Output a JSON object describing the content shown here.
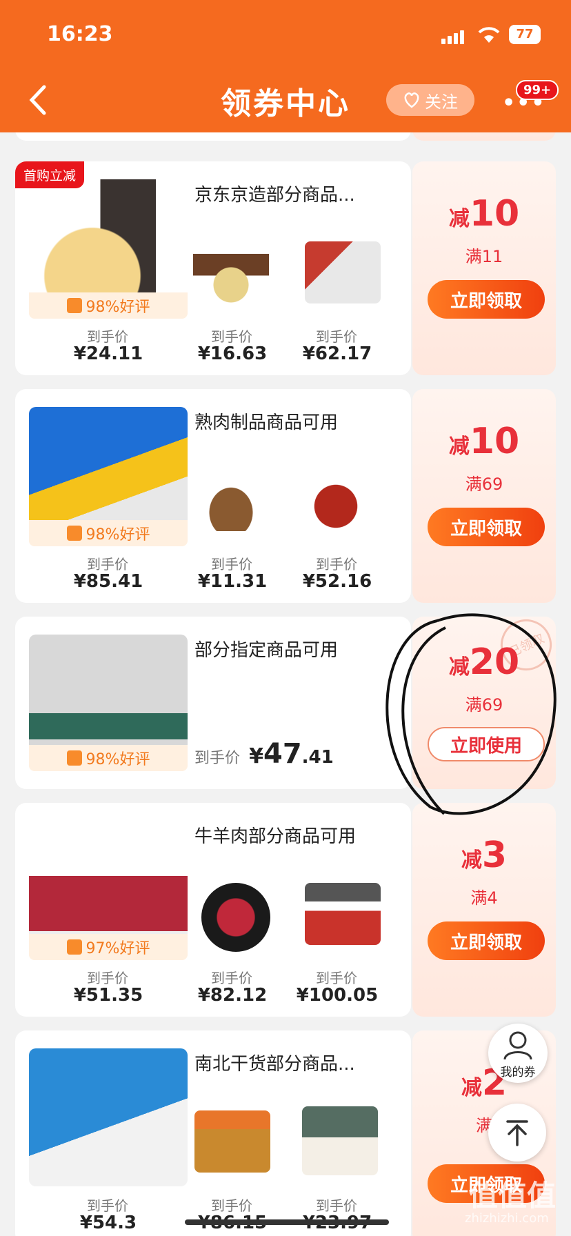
{
  "status_bar": {
    "time": "16:23",
    "battery": "77"
  },
  "nav": {
    "title": "领券中心",
    "follow_label": "关注",
    "more_label": "•••",
    "badge": "99+"
  },
  "cards": [
    {
      "tag": "首购立减",
      "name": "京东京造部分商品...",
      "rating": "98%好评",
      "price_label": "到手价",
      "prices": [
        "¥24.11",
        "¥16.63",
        "¥62.17"
      ],
      "coupon": {
        "minus_prefix": "减",
        "amount": "10",
        "min": "满11",
        "button": "立即领取"
      }
    },
    {
      "name": "熟肉制品商品可用",
      "rating": "98%好评",
      "price_label": "到手价",
      "prices": [
        "¥85.41",
        "¥11.31",
        "¥52.16"
      ],
      "coupon": {
        "minus_prefix": "减",
        "amount": "10",
        "min": "满69",
        "button": "立即领取"
      }
    },
    {
      "name": "部分指定商品可用",
      "rating": "98%好评",
      "price_label": "到手价",
      "big_price_symbol": "¥",
      "big_price_int": "47",
      "big_price_dec": ".41",
      "coupon": {
        "minus_prefix": "减",
        "amount": "20",
        "min": "满69",
        "button": "立即使用",
        "stamp": "已领取"
      }
    },
    {
      "name": "牛羊肉部分商品可用",
      "rating": "97%好评",
      "price_label": "到手价",
      "prices": [
        "¥51.35",
        "¥82.12",
        "¥100.05"
      ],
      "coupon": {
        "minus_prefix": "减",
        "amount": "3",
        "min": "满4",
        "button": "立即领取"
      }
    },
    {
      "name": "南北干货部分商品...",
      "price_label": "到手价",
      "prices": [
        "¥54.3",
        "¥86.15",
        "¥23.97"
      ],
      "coupon": {
        "minus_prefix": "减",
        "amount": "2",
        "min": "满",
        "button": "立即领取"
      }
    }
  ],
  "floating": {
    "my_coupons": "我的券"
  },
  "watermark": {
    "text": "值值值",
    "url": "zhizhizhi.com"
  },
  "colors": {
    "brand": "#f56a1f",
    "accent": "#e8303a"
  }
}
